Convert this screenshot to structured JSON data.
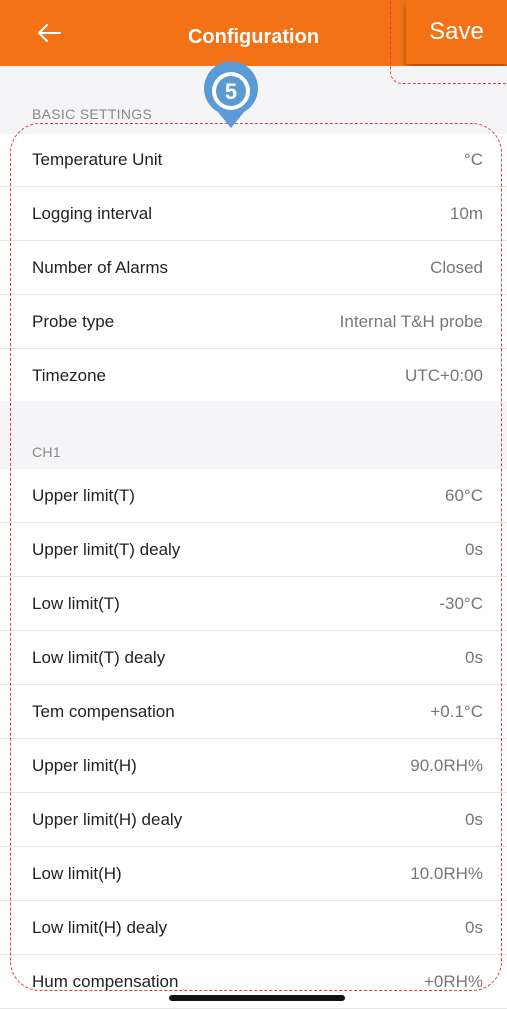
{
  "header": {
    "title": "Configuration",
    "save_label": "Save"
  },
  "marker": {
    "number": "5"
  },
  "sections": [
    {
      "label": "BASIC SETTINGS",
      "rows": [
        {
          "label": "Temperature Unit",
          "value": "°C"
        },
        {
          "label": "Logging interval",
          "value": "10m"
        },
        {
          "label": "Number of Alarms",
          "value": "Closed"
        },
        {
          "label": "Probe type",
          "value": "Internal T&H probe"
        },
        {
          "label": "Timezone",
          "value": "UTC+0:00"
        }
      ]
    },
    {
      "label": "CH1",
      "rows": [
        {
          "label": "Upper limit(T)",
          "value": "60°C"
        },
        {
          "label": "Upper limit(T) dealy",
          "value": "0s"
        },
        {
          "label": "Low limit(T)",
          "value": "-30°C"
        },
        {
          "label": "Low limit(T) dealy",
          "value": "0s"
        },
        {
          "label": "Tem compensation",
          "value": "+0.1°C"
        },
        {
          "label": "Upper limit(H)",
          "value": "90.0RH%"
        },
        {
          "label": "Upper limit(H) dealy",
          "value": "0s"
        },
        {
          "label": "Low limit(H)",
          "value": "10.0RH%"
        },
        {
          "label": "Low limit(H) dealy",
          "value": "0s"
        },
        {
          "label": "Hum compensation",
          "value": "+0RH%"
        }
      ]
    }
  ],
  "colors": {
    "accent": "#f47216",
    "annotation": "#e83a3a",
    "marker": "#5b9bd5"
  }
}
